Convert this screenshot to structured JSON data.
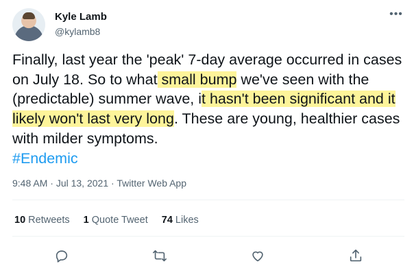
{
  "author": {
    "name": "Kyle Lamb",
    "handle": "@kylamb8"
  },
  "tweet": {
    "segments": [
      {
        "text": "Finally, last year the 'peak' 7-day average occurred in cases on July 18. So to what",
        "highlight": false
      },
      {
        "text": " small bump",
        "highlight": true
      },
      {
        "text": " we've seen with the (predictable) summer wave, i",
        "highlight": false
      },
      {
        "text": "t hasn't been significant and it likely won't last very long",
        "highlight": true
      },
      {
        "text": ". These are young, healthier cases with milder symptoms.",
        "highlight": false
      }
    ],
    "hashtag": "#Endemic",
    "highlight_color": "#fdf49a"
  },
  "meta": {
    "time": "9:48 AM",
    "date": "Jul 13, 2021",
    "source": "Twitter Web App"
  },
  "stats": {
    "retweets_count": "10",
    "retweets_label": "Retweets",
    "quote_count": "1",
    "quote_label": "Quote Tweet",
    "likes_count": "74",
    "likes_label": "Likes"
  },
  "actions": [
    "reply-icon",
    "retweet-icon",
    "like-icon",
    "share-icon"
  ]
}
